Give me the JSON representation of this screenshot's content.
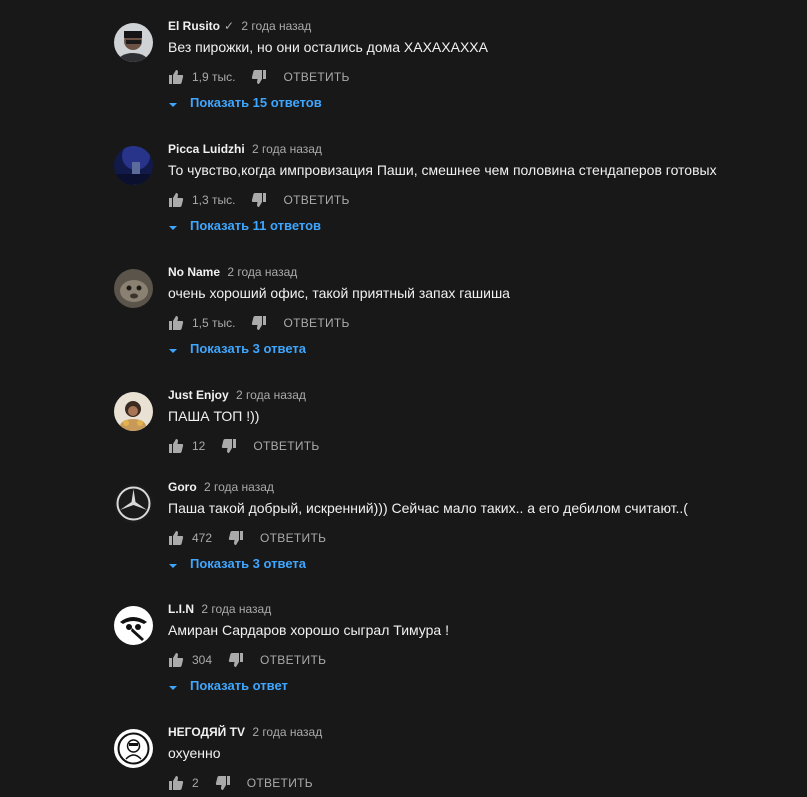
{
  "comments": [
    {
      "author": "El Rusito",
      "verified": "✓",
      "time": "2 года назад",
      "text": "Вез пирожки, но они остались дома ХАХАХАХХА",
      "likes": "1,9 тыс.",
      "reply": "ОТВЕТИТЬ",
      "replies": "Показать 15 ответов"
    },
    {
      "author": "Picca Luidzhi",
      "time": "2 года назад",
      "text": "То чувство,когда импровизация Паши, смешнее чем половина стендаперов готовых",
      "likes": "1,3 тыс.",
      "reply": "ОТВЕТИТЬ",
      "replies": "Показать 11 ответов"
    },
    {
      "author": "No Name",
      "time": "2 года назад",
      "text": "очень хороший офис, такой приятный запах гашиша",
      "likes": "1,5 тыс.",
      "reply": "ОТВЕТИТЬ",
      "replies": "Показать 3 ответа"
    },
    {
      "author": "Just Enjoy",
      "time": "2 года назад",
      "text": "ПАША ТОП !))",
      "likes": "12",
      "reply": "ОТВЕТИТЬ"
    },
    {
      "author": "Goro",
      "time": "2 года назад",
      "text": "Паша такой добрый, искренний))) Сейчас мало таких.. а его дебилом считают..(",
      "likes": "472",
      "reply": "ОТВЕТИТЬ",
      "replies": "Показать 3 ответа"
    },
    {
      "author": "L.I.N",
      "time": "2 года назад",
      "text": "Амиран Сардаров хорошо сыграл Тимура !",
      "likes": "304",
      "reply": "ОТВЕТИТЬ",
      "replies": "Показать ответ"
    },
    {
      "author": "НЕГОДЯЙ TV",
      "time": "2 года назад",
      "text": "охуенно",
      "likes": "2",
      "reply": "ОТВЕТИТЬ"
    }
  ],
  "colors": {
    "background": "#181818",
    "link": "#3ea6ff",
    "secondary": "#aaaaaa",
    "text": "#f1f1f1"
  }
}
